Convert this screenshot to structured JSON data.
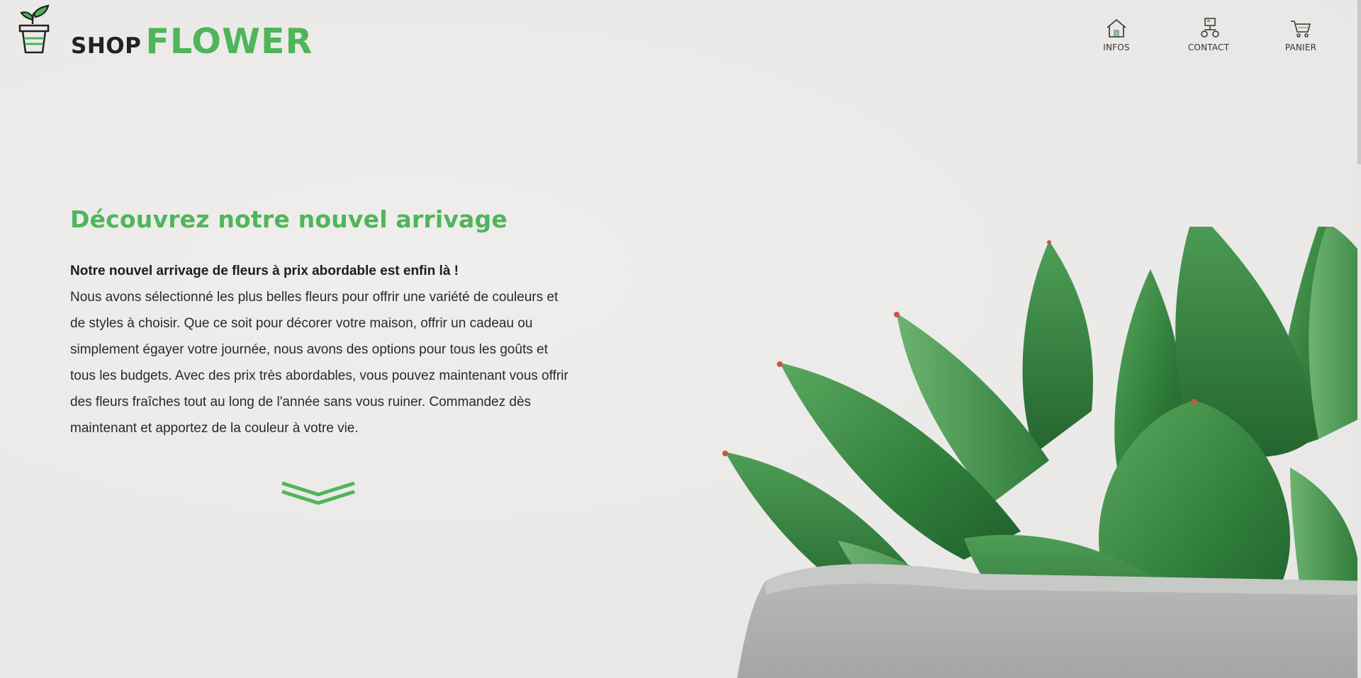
{
  "brand": {
    "shop": "SHOP",
    "flower": "FLOWER",
    "logo_icon": "flower-pot-icon",
    "accent_color": "#4fb55a"
  },
  "nav": {
    "items": [
      {
        "label": "INFOS",
        "icon": "home-icon"
      },
      {
        "label": "CONTACT",
        "icon": "contact-network-icon"
      },
      {
        "label": "PANIER",
        "icon": "cart-icon"
      }
    ]
  },
  "hero": {
    "title": "Découvrez notre nouvel arrivage",
    "lead": "Notre nouvel arrivage de fleurs à prix abordable est enfin là !",
    "body": "Nous avons sélectionné les plus belles fleurs pour offrir une variété de couleurs et de styles à choisir. Que ce soit pour décorer votre maison, offrir un cadeau ou simplement égayer votre journée, nous avons des options pour tous les goûts et tous les budgets. Avec des prix très abordables, vous pouvez maintenant vous offrir des fleurs fraîches tout au long de l'année sans vous ruiner. Commandez dès maintenant et apportez de la couleur à votre vie.",
    "scroll_icon": "double-chevron-down-icon",
    "image": "succulent-plant-image"
  }
}
